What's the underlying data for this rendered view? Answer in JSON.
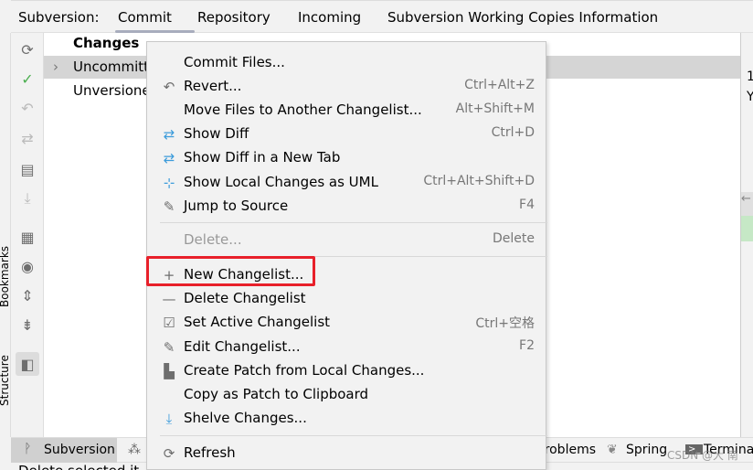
{
  "tabbar": {
    "label": "Subversion:",
    "tabs": [
      "Commit",
      "Repository",
      "Incoming",
      "Subversion Working Copies Information"
    ],
    "active": "Commit"
  },
  "side_labels": [
    "Bookmarks",
    "Structure"
  ],
  "toolbar": {
    "icons": [
      "refresh-icon",
      "commit-check-icon",
      "rollback-icon",
      "show-diff-icon",
      "changelist-icon",
      "update-icon",
      "group-by-icon",
      "view-options-icon",
      "expand-all-icon",
      "collapse-all-icon",
      "preview-toggle-icon"
    ]
  },
  "tree": {
    "header": "Changes",
    "rows": [
      "Uncommitte",
      "Unversione"
    ]
  },
  "right_panel": {
    "lines": [
      "1",
      "Y"
    ]
  },
  "menu": {
    "items": [
      {
        "label": "Commit Files...",
        "shortcut": "",
        "icon": ""
      },
      {
        "label": "Revert...",
        "shortcut": "Ctrl+Alt+Z",
        "icon": "revert-icon"
      },
      {
        "label": "Move Files to Another Changelist...",
        "shortcut": "Alt+Shift+M",
        "icon": ""
      },
      {
        "label": "Show Diff",
        "shortcut": "Ctrl+D",
        "icon": "diff-icon"
      },
      {
        "label": "Show Diff in a New Tab",
        "shortcut": "",
        "icon": "diff-icon"
      },
      {
        "label": "Show Local Changes as UML",
        "shortcut": "Ctrl+Alt+Shift+D",
        "icon": "uml-icon"
      },
      {
        "label": "Jump to Source",
        "shortcut": "F4",
        "icon": "pencil-icon"
      },
      {
        "label": "Delete...",
        "shortcut": "Delete",
        "icon": "",
        "disabled": true
      },
      {
        "label": "New Changelist...",
        "shortcut": "",
        "icon": "plus-icon",
        "highlighted": true
      },
      {
        "label": "Delete Changelist",
        "shortcut": "",
        "icon": "minus-icon"
      },
      {
        "label": "Set Active Changelist",
        "shortcut": "Ctrl+空格",
        "icon": "checkbox-icon"
      },
      {
        "label": "Edit Changelist...",
        "shortcut": "F2",
        "icon": "pencil-icon"
      },
      {
        "label": "Create Patch from Local Changes...",
        "shortcut": "",
        "icon": "patch-icon"
      },
      {
        "label": "Copy as Patch to Clipboard",
        "shortcut": "",
        "icon": ""
      },
      {
        "label": "Shelve Changes...",
        "shortcut": "",
        "icon": "shelve-icon"
      },
      {
        "label": "Refresh",
        "shortcut": "",
        "icon": "refresh-icon"
      }
    ]
  },
  "bottombar": {
    "items": [
      "Subversion",
      "Problems",
      "Spring",
      "Terminal"
    ]
  },
  "status": {
    "text": "Delete selected it"
  },
  "watermark": "CSDN @大 南",
  "colors": {
    "highlight_box": "#e8202a",
    "selected_row": "#d5d5d5",
    "accent_blue": "#3d9cdb",
    "check_green": "#4caf50"
  }
}
